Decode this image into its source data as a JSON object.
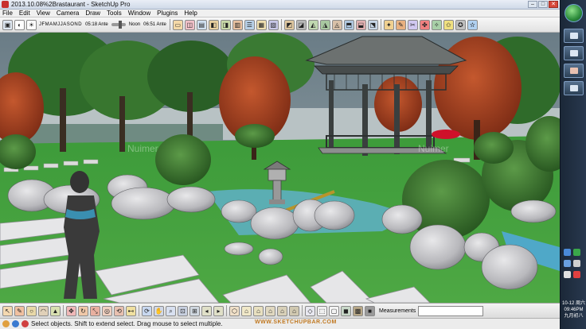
{
  "window": {
    "title": "2013.10.08%2Brastaurant - SketchUp Pro",
    "minimize": "–",
    "maximize": "□",
    "close": "✕"
  },
  "menu": [
    "File",
    "Edit",
    "View",
    "Camera",
    "Draw",
    "Tools",
    "Window",
    "Plugins",
    "Help"
  ],
  "shadows": {
    "months": [
      "J",
      "F",
      "M",
      "A",
      "M",
      "J",
      "J",
      "A",
      "S",
      "O",
      "N",
      "D"
    ],
    "time_start": "05:18 Ante",
    "time_noon": "Noon",
    "time_end": "06:51 Ante"
  },
  "measurements": {
    "label": "Measurements",
    "value": ""
  },
  "status": {
    "hint": "Select objects. Shift to extend select. Drag mouse to select multiple."
  },
  "watermarks": {
    "url": "WWW.SKETCHUPBAR.COM",
    "viewport_mark": "Nuimer"
  },
  "clock": {
    "time": "10-12 周六",
    "date": "09:46PM",
    "lunar": "九月初八"
  },
  "colors": {
    "accent_red": "#c8302e",
    "grass": "#3d9b3a",
    "taskbar": "#1b2838"
  }
}
